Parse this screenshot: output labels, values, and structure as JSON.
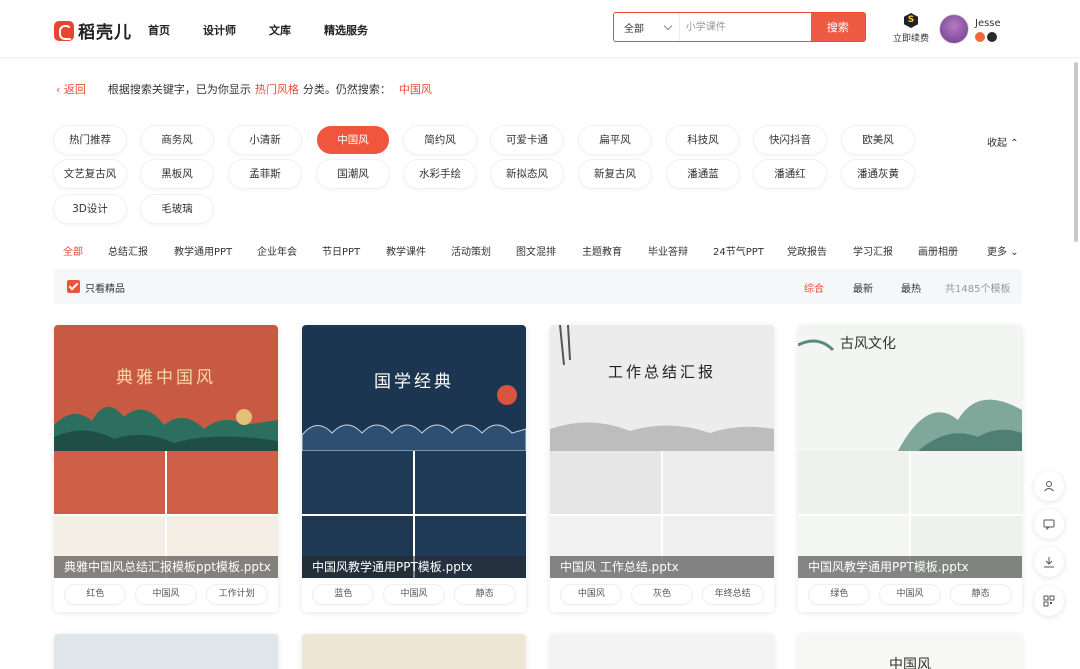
{
  "header": {
    "logo_text": "稻壳儿",
    "nav": [
      "首页",
      "设计师",
      "文库",
      "精选服务"
    ],
    "search": {
      "scope": "全部",
      "placeholder": "小学课件",
      "button": "搜索"
    },
    "renew_label": "立即续费",
    "username": "Jesse"
  },
  "breadcrumb": {
    "back": "返回",
    "prefix": "根据搜索关键字，已为你显示",
    "category": "热门风格",
    "mid": "分类。仍然搜索：",
    "keyword": "中国风"
  },
  "styles": {
    "items": [
      "热门推荐",
      "商务风",
      "小清新",
      "中国风",
      "简约风",
      "可爱卡通",
      "扁平风",
      "科技风",
      "快闪抖音",
      "欧美风",
      "文艺复古风",
      "黑板风",
      "孟菲斯",
      "国潮风",
      "水彩手绘",
      "新拟态风",
      "新复古风",
      "潘通蓝",
      "潘通红",
      "潘通灰黄",
      "3D设计",
      "毛玻璃"
    ],
    "active": "中国风",
    "collapse": "收起"
  },
  "categories": {
    "items": [
      "全部",
      "总结汇报",
      "教学通用PPT",
      "企业年会",
      "节日PPT",
      "教学课件",
      "活动策划",
      "图文混排",
      "主题教育",
      "毕业答辩",
      "24节气PPT",
      "党政报告",
      "学习汇报",
      "画册相册"
    ],
    "more": "更多"
  },
  "filter": {
    "premium_only": "只看精品",
    "sort": [
      "综合",
      "最新",
      "最热"
    ],
    "count": "共1485个模板"
  },
  "cards": [
    {
      "title": "典雅中国风总结汇报模板ppt模板.pptx",
      "tags": [
        "红色",
        "中国风",
        "工作计划"
      ],
      "cover_text": "典雅中国风"
    },
    {
      "title": "中国风教学通用PPT模板.pptx",
      "tags": [
        "蓝色",
        "中国风",
        "静态"
      ],
      "cover_text": "国学经典"
    },
    {
      "title": "中国风 工作总结.pptx",
      "tags": [
        "中国风",
        "灰色",
        "年终总结"
      ],
      "cover_text": "工作总结汇报"
    },
    {
      "title": "中国风教学通用PPT模板.pptx",
      "tags": [
        "绿色",
        "中国风",
        "静态"
      ],
      "cover_text": "古风文化"
    }
  ],
  "bottom_cards": [
    {
      "cover_text": ""
    },
    {
      "cover_text": ""
    },
    {
      "cover_text": ""
    },
    {
      "cover_text": "中国风"
    }
  ],
  "colors": {
    "accent": "#e84a35",
    "card1": "#c85a43",
    "card2": "#1c3550",
    "card3": "#e9e9e9",
    "card4": "#f3f5f3"
  }
}
